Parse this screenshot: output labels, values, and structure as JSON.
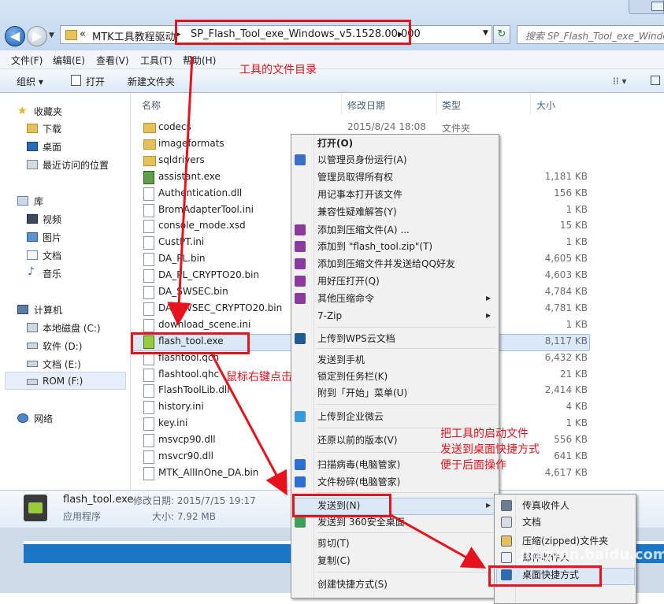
{
  "address": {
    "nav_prefix": "«",
    "crumb1": "MTK工具教程驱动",
    "sep1": "▸",
    "crumb2": "SP_Flash_Tool_exe_Windows_v5.1528.00.000",
    "sep2": "▸",
    "search_placeholder": "搜索 SP_Flash_Tool_exe_Windows..."
  },
  "menubar": [
    "文件(F)",
    "编辑(E)",
    "查看(V)",
    "工具(T)",
    "帮助(H)"
  ],
  "toolbar": {
    "organize": "组织 ▾",
    "open": "打开",
    "new_folder": "新建文件夹"
  },
  "nav": {
    "favorites": "收藏夹",
    "favorites_items": [
      "下载",
      "桌面",
      "最近访问的位置"
    ],
    "libraries": "库",
    "libraries_items": [
      "视频",
      "图片",
      "文档",
      "音乐"
    ],
    "computer": "计算机",
    "computer_items": [
      "本地磁盘 (C:)",
      "软件 (D:)",
      "文档 (E:)",
      "ROM (F:)"
    ],
    "network": "网络"
  },
  "columns": {
    "name": "名称",
    "date": "修改日期",
    "type": "类型",
    "size": "大小"
  },
  "files": [
    {
      "name": "codecs",
      "date": "2015/8/24 18:08",
      "type": "文件夹",
      "size": ""
    },
    {
      "name": "imageformats",
      "date": "",
      "type": "",
      "size": ""
    },
    {
      "name": "sqldrivers",
      "date": "",
      "type": "",
      "size": ""
    },
    {
      "name": "assistant.exe",
      "date": "",
      "type": "",
      "size": "1,181 KB"
    },
    {
      "name": "Authentication.dll",
      "date": "",
      "type": "",
      "size": "156 KB"
    },
    {
      "name": "BromAdapterTool.ini",
      "date": "",
      "type": "",
      "size": "1 KB"
    },
    {
      "name": "console_mode.xsd",
      "date": "",
      "type": "",
      "size": "15 KB"
    },
    {
      "name": "CustPT.ini",
      "date": "",
      "type": "",
      "size": "1 KB"
    },
    {
      "name": "DA_PL.bin",
      "date": "",
      "type": "",
      "size": "4,605 KB"
    },
    {
      "name": "DA_PL_CRYPTO20.bin",
      "date": "",
      "type": "",
      "size": "4,603 KB"
    },
    {
      "name": "DA_SWSEC.bin",
      "date": "",
      "type": "",
      "size": "4,784 KB"
    },
    {
      "name": "DA_SWSEC_CRYPTO20.bin",
      "date": "",
      "type": "",
      "size": "4,781 KB"
    },
    {
      "name": "download_scene.ini",
      "date": "",
      "type": "",
      "size": "1 KB"
    },
    {
      "name": "flash_tool.exe",
      "date": "",
      "type": "",
      "size": "8,117 KB"
    },
    {
      "name": "flashtool.qch",
      "date": "",
      "type": "",
      "size": "6,432 KB"
    },
    {
      "name": "flashtool.qhc",
      "date": "",
      "type": "",
      "size": "21 KB"
    },
    {
      "name": "FlashToolLib.dll",
      "date": "",
      "type": "",
      "size": "2,414 KB"
    },
    {
      "name": "history.ini",
      "date": "",
      "type": "",
      "size": "4 KB"
    },
    {
      "name": "key.ini",
      "date": "",
      "type": "",
      "size": "1 KB"
    },
    {
      "name": "msvcp90.dll",
      "date": "",
      "type": "",
      "size": "556 KB"
    },
    {
      "name": "msvcr90.dll",
      "date": "",
      "type": "",
      "size": "641 KB"
    },
    {
      "name": "MTK_AllInOne_DA.bin",
      "date": "",
      "type": "",
      "size": "4,617 KB"
    }
  ],
  "details": {
    "name": "flash_tool.exe",
    "kind": "应用程序",
    "modified": "修改日期: 2015/7/15 19:17",
    "size": "大小: 7.92 MB"
  },
  "context_menu": [
    "打开(O)",
    "以管理员身份运行(A)",
    "管理员取得所有权",
    "用记事本打开该文件",
    "兼容性疑难解答(Y)",
    "添加到压缩文件(A) ...",
    "添加到 \"flash_tool.zip\"(T)",
    "添加到压缩文件并发送给QQ好友",
    "用好压打开(Q)",
    "其他压缩命令",
    "7-Zip",
    "上传到WPS云文档",
    "发送到手机",
    "锁定到任务栏(K)",
    "附到「开始」菜单(U)",
    "上传到企业微云",
    "还原以前的版本(V)",
    "扫描病毒(电脑管家)",
    "文件粉碎(电脑管家)",
    "发送到(N)",
    "发送到 360安全桌面",
    "剪切(T)",
    "复制(C)",
    "创建快捷方式(S)"
  ],
  "submenu": [
    "传真收件人",
    "文档",
    "压缩(zipped)文件夹",
    "邮件收件人",
    "桌面快捷方式"
  ],
  "annotations": {
    "tool_dir": "工具的文件目录",
    "right_click": "鼠标右键点击",
    "tip_line1": "把工具的启动文件",
    "tip_line2": "发送到桌面快捷方式",
    "tip_line3": "便于后面操作"
  },
  "watermark": "Jingyan.baidu.com",
  "colors": {
    "annotation_red": "#e8121c",
    "selection_blue": "#dbe8f8",
    "accent_blue": "#1b77c5"
  }
}
